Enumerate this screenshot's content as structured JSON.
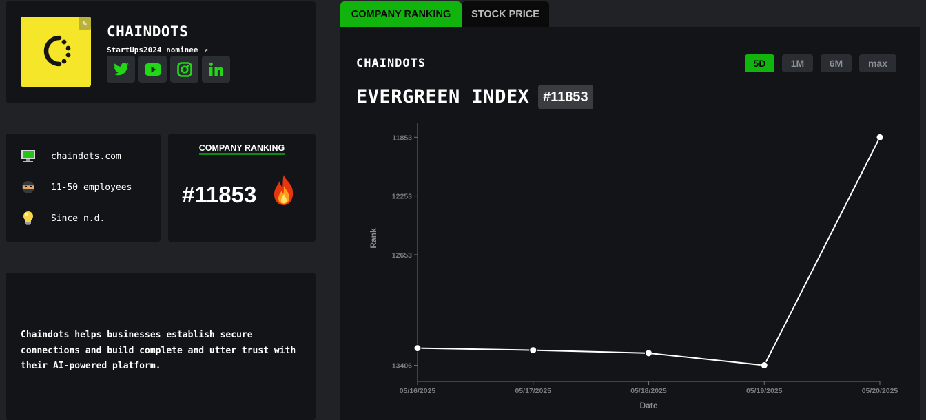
{
  "profile": {
    "company_name": "CHAINDOTS",
    "nominee": "StartUps2024 nominee",
    "socials": [
      "twitter-icon",
      "youtube-icon",
      "instagram-icon",
      "linkedin-icon"
    ]
  },
  "info": {
    "website": "chaindots.com",
    "employees": "11-50 employees",
    "since": "Since n.d."
  },
  "ranking_card": {
    "title": "COMPANY RANKING",
    "rank": "#11853"
  },
  "description": "Chaindots helps businesses establish secure connections and build complete and utter trust with their AI-powered platform.",
  "tabs": [
    {
      "label": "COMPANY RANKING",
      "active": true
    },
    {
      "label": "STOCK PRICE",
      "active": false
    }
  ],
  "panel": {
    "company": "CHAINDOTS",
    "index_title": "EVERGREEN INDEX",
    "index_badge": "#11853",
    "ranges": [
      {
        "label": "5D",
        "active": true
      },
      {
        "label": "1M",
        "active": false
      },
      {
        "label": "6M",
        "active": false
      },
      {
        "label": "max",
        "active": false
      }
    ]
  },
  "colors": {
    "accent": "#11b40c",
    "background": "#202226",
    "card": "#131417"
  },
  "chart_data": {
    "type": "line",
    "xlabel": "Date",
    "ylabel": "Rank",
    "x": [
      "05/16/2025",
      "05/17/2025",
      "05/18/2025",
      "05/19/2025",
      "05/20/2025"
    ],
    "values": [
      13289,
      13303,
      13323,
      13406,
      11853
    ],
    "yticks": [
      11853,
      12253,
      12653,
      13406
    ],
    "ylim": [
      11753,
      13516
    ],
    "y_inverted": true,
    "grid": false
  }
}
